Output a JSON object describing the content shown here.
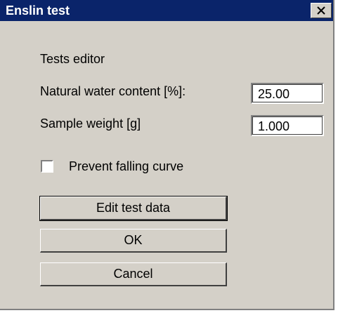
{
  "window": {
    "title": "Enslin test"
  },
  "section": {
    "heading": "Tests editor"
  },
  "fields": {
    "water_label": "Natural water content [%]:",
    "water_value": "25.00",
    "weight_label": "Sample weight [g]",
    "weight_value": "1.000"
  },
  "checkbox": {
    "label": "Prevent falling curve",
    "checked": false
  },
  "buttons": {
    "edit": "Edit test data",
    "ok": "OK",
    "cancel": "Cancel"
  }
}
